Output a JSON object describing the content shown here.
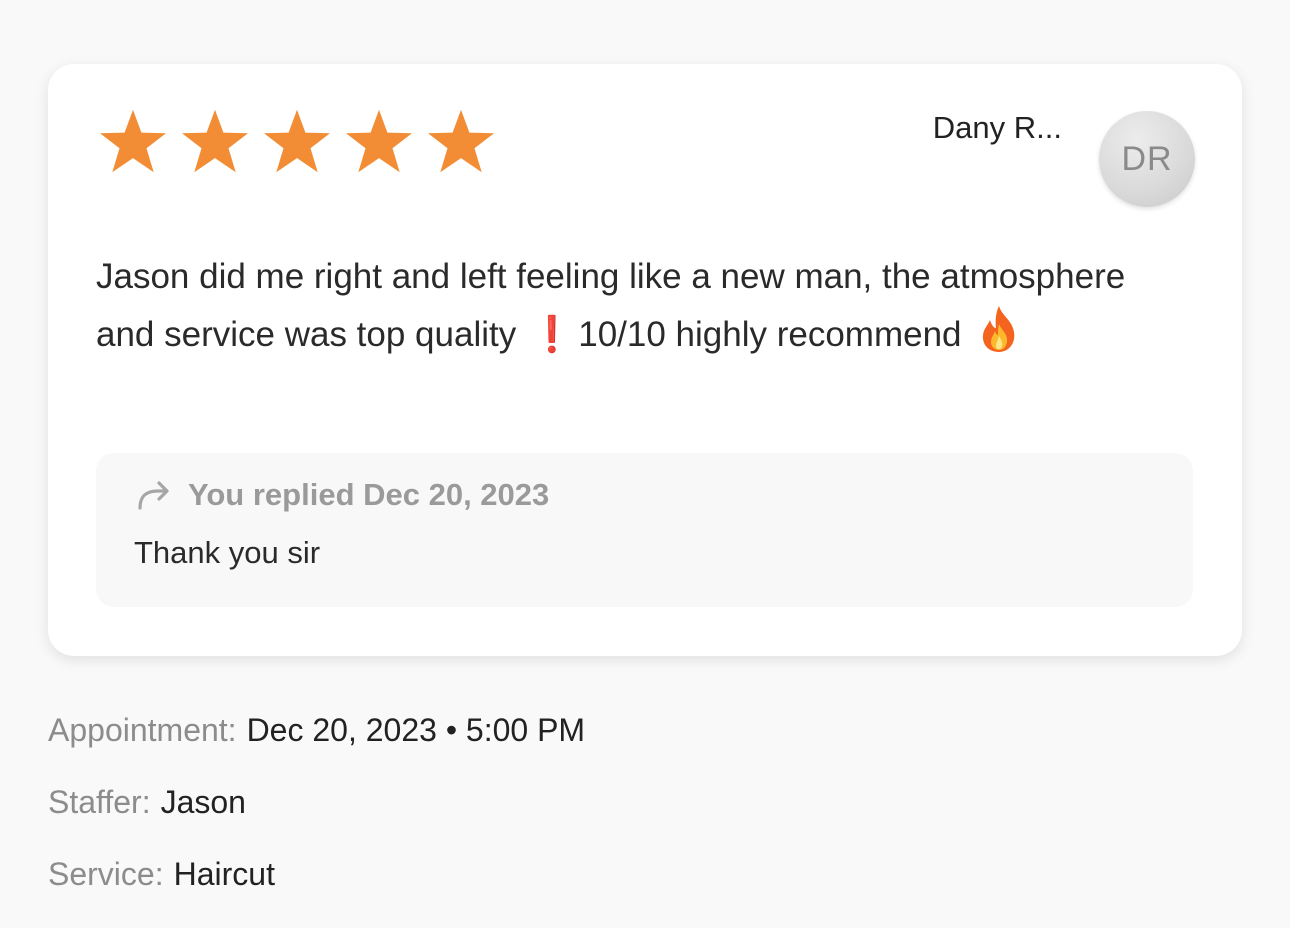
{
  "review": {
    "rating": 5,
    "rating_max": 5,
    "star_color": "#f28d35",
    "reviewer_name": "Dany R...",
    "avatar_initials": "DR",
    "text_part1": "Jason did me right and left feeling like a new man, the atmosphere and service was top quality",
    "emoji_exclamation": "❗",
    "text_part2": "10/10 highly recommend",
    "emoji_fire": "🔥"
  },
  "reply": {
    "header": "You replied Dec 20, 2023",
    "text": "Thank you sir",
    "icon": "reply-arrow-icon"
  },
  "details": {
    "appointment_label": "Appointment:",
    "appointment_value": "Dec 20, 2023 • 5:00 PM",
    "staffer_label": "Staffer:",
    "staffer_value": "Jason",
    "service_label": "Service:",
    "service_value": "Haircut"
  }
}
